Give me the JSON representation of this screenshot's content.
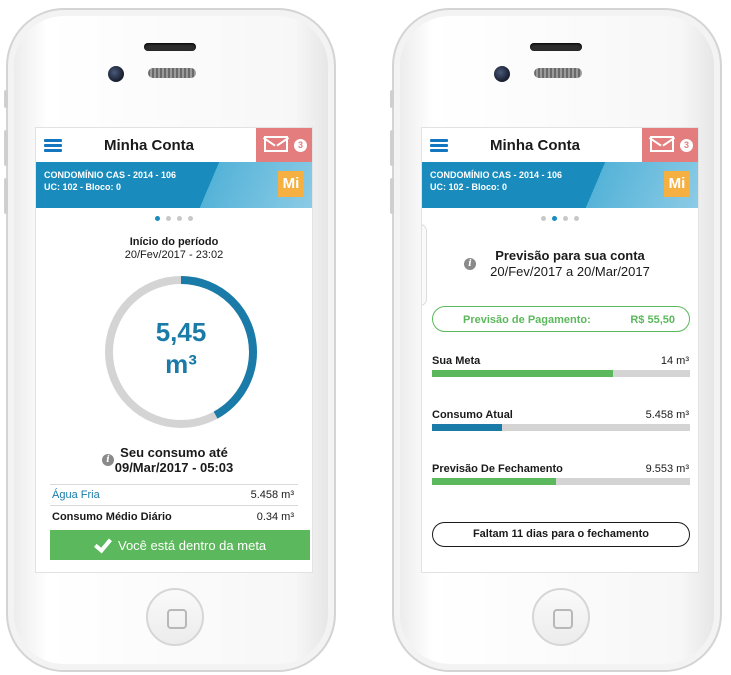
{
  "colors": {
    "brand_blue": "#1a8bbd",
    "accent_green": "#5cb85c",
    "mail_red": "#e47d7d",
    "mi_orange": "#f5b041",
    "track_gray": "#d4d4d4"
  },
  "left_screen": {
    "header": {
      "title": "Minha Conta",
      "mail_count": "3"
    },
    "condo": {
      "name": "CONDOMÍNIO CAS - 2014 - 106",
      "unit": "UC: 102 - Bloco: 0",
      "badge": "Mi"
    },
    "page_indicator": {
      "total": 4,
      "active": 1
    },
    "period": {
      "label": "Início do período",
      "date": "20/Fev/2017 - 23:02"
    },
    "gauge": {
      "value": "5,45",
      "unit": "m³",
      "fill_fraction": 0.42
    },
    "consumo": {
      "title": "Seu consumo até",
      "date": "09/Mar/2017 - 05:03"
    },
    "rows": [
      {
        "label": "Água Fria",
        "value": "5.458 m³"
      },
      {
        "label": "Consumo Médio Diário",
        "value": "0.34 m³"
      }
    ],
    "meta_status": "Você está dentro da meta"
  },
  "right_screen": {
    "header": {
      "title": "Minha Conta",
      "mail_count": "3"
    },
    "condo": {
      "name": "CONDOMÍNIO CAS - 2014 - 106",
      "unit": "UC: 102 - Bloco: 0",
      "badge": "Mi"
    },
    "page_indicator": {
      "total": 4,
      "active": 2
    },
    "forecast": {
      "title": "Previsão para sua conta",
      "dates": "20/Fev/2017 a 20/Mar/2017"
    },
    "payment": {
      "label": "Previsão de Pagamento:",
      "value": "R$ 55,50"
    },
    "stats": [
      {
        "label": "Sua Meta",
        "value": "14 m³",
        "fill_fraction": 0.7,
        "color": "#5cb85c"
      },
      {
        "label": "Consumo Atual",
        "value": "5.458 m³",
        "fill_fraction": 0.27,
        "color": "#1a7ba8"
      },
      {
        "label": "Previsão De Fechamento",
        "value": "9.553 m³",
        "fill_fraction": 0.48,
        "color": "#5cb85c"
      }
    ],
    "closing_button": "Faltam 11 dias para o fechamento"
  }
}
